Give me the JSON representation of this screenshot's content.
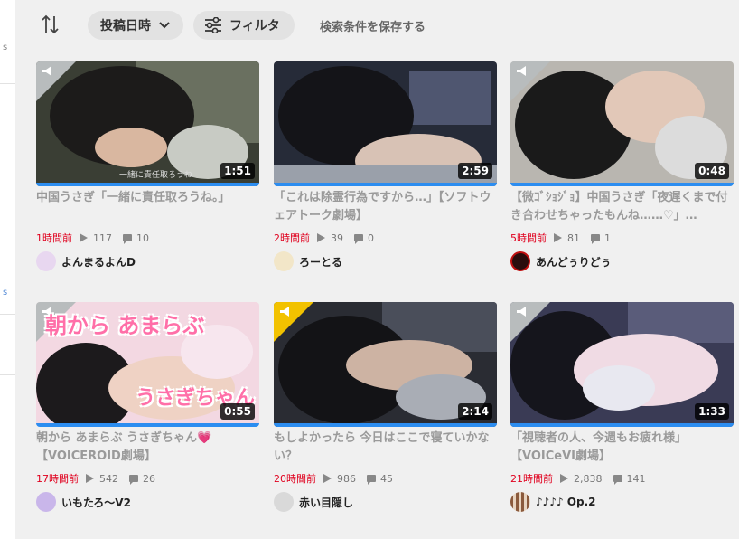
{
  "toolbar": {
    "sort_label": "投稿日時",
    "filter_label": "フィルタ",
    "save_label": "検索条件を保存する"
  },
  "left_strip": {
    "mark1": "s",
    "mark2": "s"
  },
  "videos": [
    {
      "title": "中国うさぎ「一緒に責任取ろうね。」",
      "duration": "1:51",
      "time": "1時間前",
      "views": "117",
      "comments": "10",
      "owner": "よんまるよんD",
      "caption": "一緒に責任取ろうね"
    },
    {
      "title": "「これは除霊行為ですから…」【ソフトウェアトーク劇場】",
      "duration": "2:59",
      "time": "2時間前",
      "views": "39",
      "comments": "0",
      "owner": "ろーとる"
    },
    {
      "title": "【微ｺﾞｼｮｼﾞｮ】中国うさぎ「夜遅くまで付き合わせちゃったもんね……♡」…",
      "duration": "0:48",
      "time": "5時間前",
      "views": "81",
      "comments": "1",
      "owner": "あんどぅりどぅ"
    },
    {
      "title": "朝から あまらぶ うさぎちゃん💗【VOICEROID劇場】",
      "duration": "0:55",
      "time": "17時間前",
      "views": "542",
      "comments": "26",
      "owner": "いもたろ～V2",
      "overlay1": "朝から あまらぶ",
      "overlay2": "うさぎちゃん"
    },
    {
      "title": "もしよかったら 今日はここで寝ていかない？",
      "duration": "2:14",
      "time": "20時間前",
      "views": "986",
      "comments": "45",
      "owner": "赤い目隠し"
    },
    {
      "title": "「視聴者の人、今週もお疲れ様」【VOICeVI劇場】",
      "duration": "1:33",
      "time": "21時間前",
      "views": "2,838",
      "comments": "141",
      "owner": "♪♪♪♪ Op.2"
    }
  ],
  "colors": {
    "accent_blue": "#2c8df0",
    "time_red": "#e0001e",
    "badge_gray": "#b8bcbd",
    "badge_gold": "#f2c200"
  }
}
